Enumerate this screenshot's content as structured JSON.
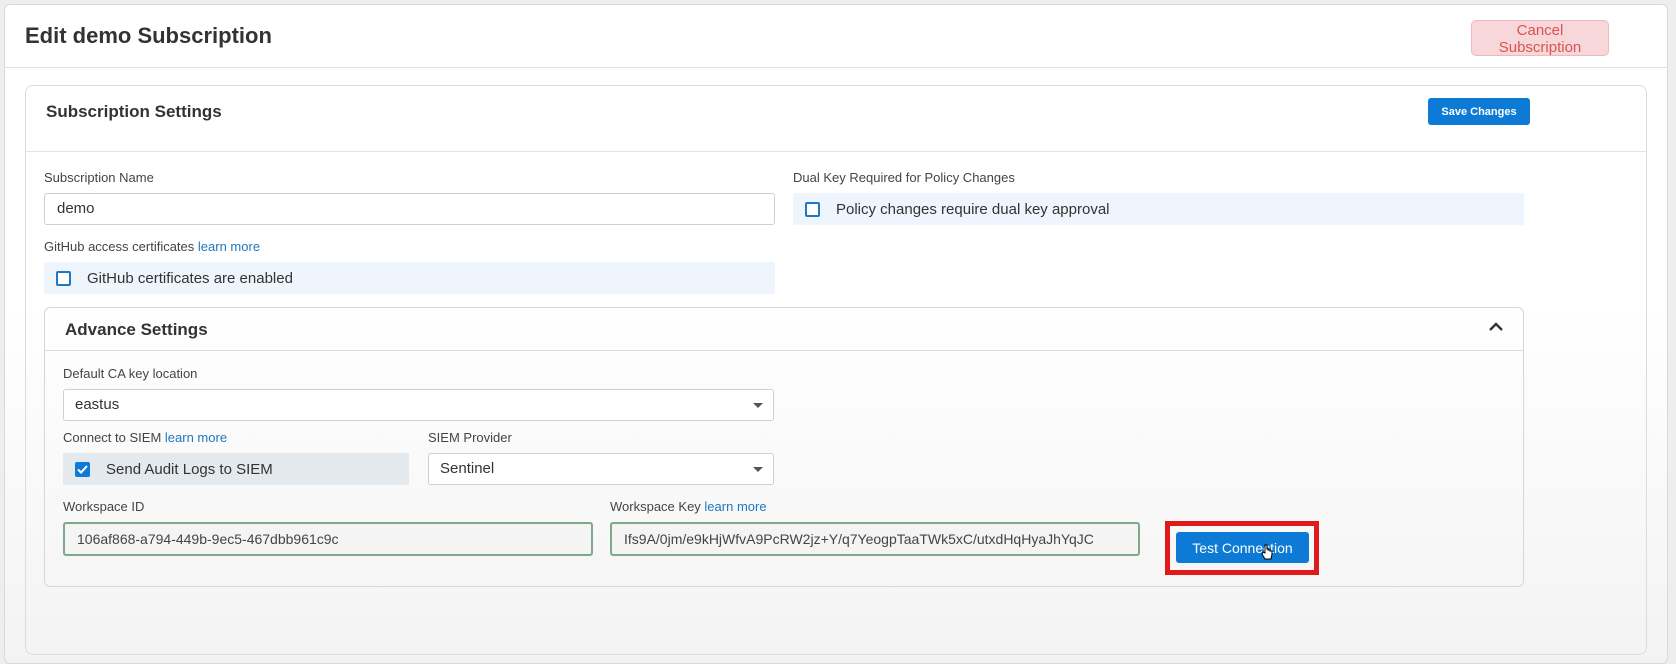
{
  "header": {
    "title": "Edit demo Subscription",
    "cancel_label": "Cancel Subscription"
  },
  "settings": {
    "title": "Subscription Settings",
    "save_label": "Save Changes",
    "subscription_name_label": "Subscription Name",
    "subscription_name_value": "demo",
    "github_label": "GitHub access certificates",
    "github_learn_more": "learn more",
    "github_checkbox_label": "GitHub certificates are enabled",
    "dual_key_label": "Dual Key Required for Policy Changes",
    "dual_key_checkbox_label": "Policy changes require dual key approval"
  },
  "advanced": {
    "title": "Advance Settings",
    "ca_location_label": "Default CA key location",
    "ca_location_value": "eastus",
    "siem_label": "Connect to SIEM",
    "siem_learn_more": "learn more",
    "siem_checkbox_label": "Send Audit Logs to SIEM",
    "siem_checked": true,
    "siem_provider_label": "SIEM Provider",
    "siem_provider_value": "Sentinel",
    "workspace_id_label": "Workspace ID",
    "workspace_id_value": "106af868-a794-449b-9ec5-467dbb961c9c",
    "workspace_key_label": "Workspace Key",
    "workspace_key_learn_more": "learn more",
    "workspace_key_value": "Ifs9A/0jm/e9kHjWfvA9PcRW2jz+Y/q7YeogpTaaTWk5xC/utxdHqHyaJhYqJC",
    "test_connection_label": "Test Connection"
  },
  "colors": {
    "accent": "#0d7bd6",
    "danger_bg": "#f8d7da",
    "danger_text": "#d9534f",
    "highlight": "#e01a1a"
  }
}
